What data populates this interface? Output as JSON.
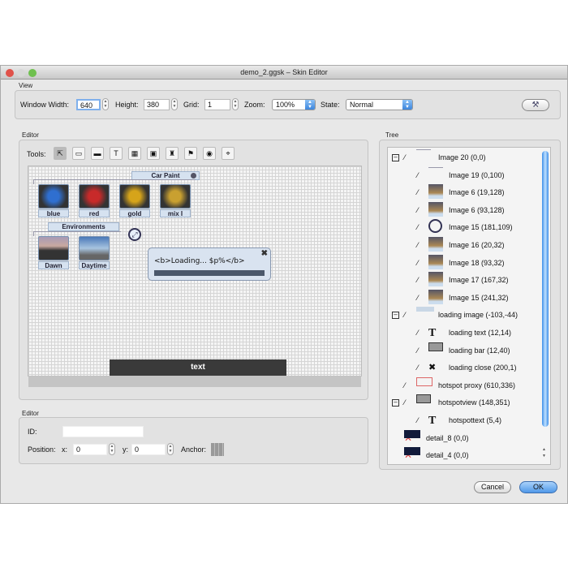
{
  "window": {
    "title": "demo_2.ggsk – Skin Editor"
  },
  "view": {
    "label": "View",
    "window_width_label": "Window Width:",
    "window_width": "640",
    "height_label": "Height:",
    "height": "380",
    "grid_label": "Grid:",
    "grid": "1",
    "zoom_label": "Zoom:",
    "zoom": "100%",
    "state_label": "State:",
    "state": "Normal"
  },
  "editor": {
    "label": "Editor",
    "tools_label": "Tools:",
    "tools": [
      "select-icon",
      "rectangle-icon",
      "image-box-icon",
      "text-icon",
      "image-icon",
      "button-icon",
      "cloner-icon",
      "map-icon",
      "globe-icon",
      "crosshair-icon"
    ],
    "canvas": {
      "car_paint": "Car Paint",
      "colors": [
        "blue",
        "red",
        "gold",
        "mix I"
      ],
      "environments": "Environments",
      "envs": [
        "Dawn",
        "Daytime"
      ],
      "loading_text": "<b>Loading... $p%</b>",
      "bottom_text": "text"
    }
  },
  "props": {
    "label": "Editor",
    "id_label": "ID:",
    "id": "",
    "position_label": "Position:",
    "x_label": "x:",
    "x": "0",
    "y_label": "y:",
    "y": "0",
    "anchor_label": "Anchor:"
  },
  "tree": {
    "label": "Tree",
    "items": [
      {
        "label": "Image 20 (0,0)",
        "level": 0,
        "toggle": true
      },
      {
        "label": "Image 19 (0,100)",
        "level": 1
      },
      {
        "label": "Image 6 (19,128)",
        "level": 1
      },
      {
        "label": "Image 6 (93,128)",
        "level": 1
      },
      {
        "label": "Image 15 (181,109)",
        "level": 1
      },
      {
        "label": "Image 16 (20,32)",
        "level": 1
      },
      {
        "label": "Image 18 (93,32)",
        "level": 1
      },
      {
        "label": "Image 17 (167,32)",
        "level": 1
      },
      {
        "label": "Image 15 (241,32)",
        "level": 1
      },
      {
        "label": "loading image (-103,-44)",
        "level": 0,
        "toggle": true
      },
      {
        "label": "loading text (12,14)",
        "level": 1
      },
      {
        "label": "loading bar (12,40)",
        "level": 1
      },
      {
        "label": "loading close (200,1)",
        "level": 1
      },
      {
        "label": "hotspot proxy (610,336)",
        "level": 0
      },
      {
        "label": "hotspotview (148,351)",
        "level": 0,
        "toggle": true
      },
      {
        "label": "hotspottext (5,4)",
        "level": 1
      },
      {
        "label": "detail_8 (0,0)",
        "level": 0,
        "hidden": true
      },
      {
        "label": "detail_4 (0,0)",
        "level": 0,
        "hidden": true
      }
    ]
  },
  "buttons": {
    "cancel": "Cancel",
    "ok": "OK"
  }
}
